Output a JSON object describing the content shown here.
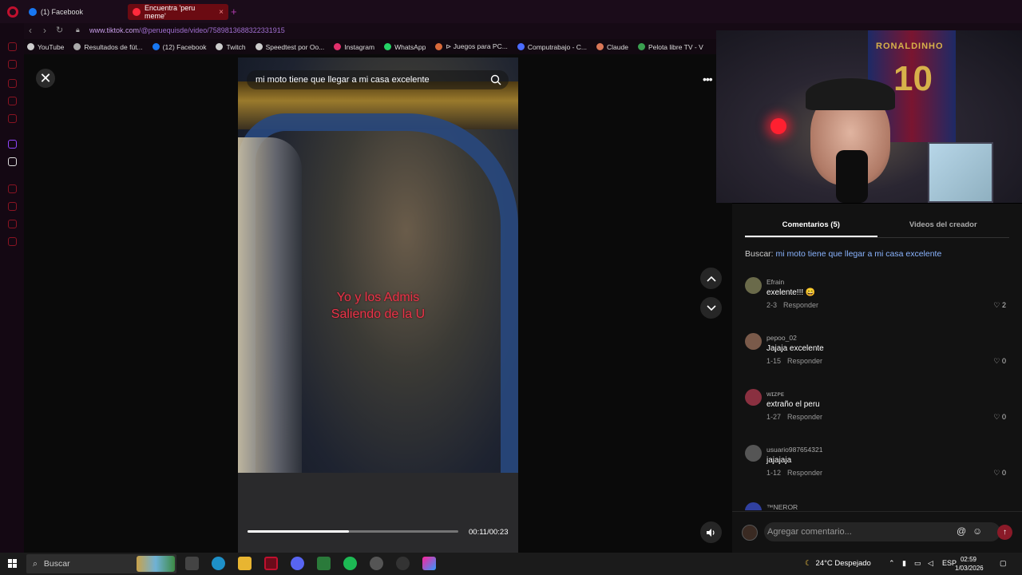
{
  "browser": {
    "tabs": [
      {
        "label": "(1) Facebook",
        "color": "#1877f2"
      },
      {
        "label": "Encuentra 'peru meme'",
        "color": "#ff2a3c",
        "active": true
      }
    ],
    "url_host": "www.tiktok.com",
    "url_path": "/@peruequisde/video/7589813688322331915",
    "bookmarks": [
      {
        "label": "YouTube",
        "icon": "page-icon",
        "color": "#cccccc"
      },
      {
        "label": "Resultados de fút...",
        "icon": "gear-icon",
        "color": "#aaaaaa"
      },
      {
        "label": "(12) Facebook",
        "icon": "facebook-icon",
        "color": "#1877f2"
      },
      {
        "label": "Twitch",
        "icon": "page-icon",
        "color": "#cccccc"
      },
      {
        "label": "Speedtest por Oo...",
        "icon": "speedtest-icon",
        "color": "#cccccc"
      },
      {
        "label": "Instagram",
        "icon": "instagram-icon",
        "color": "#e1306c"
      },
      {
        "label": "WhatsApp",
        "icon": "whatsapp-icon",
        "color": "#25d366"
      },
      {
        "label": "⊳ Juegos para PC...",
        "icon": "game-icon",
        "color": "#d86a3a"
      },
      {
        "label": "Computrabajo - C...",
        "icon": "computrabajo-icon",
        "color": "#4a6cff"
      },
      {
        "label": "Claude",
        "icon": "claude-icon",
        "color": "#d97757"
      },
      {
        "label": "Pelota libre TV - V",
        "icon": "tv-icon",
        "color": "#3aa050"
      }
    ]
  },
  "video": {
    "search_query": "mi moto tiene que llegar a mi casa excelente",
    "caption_line1": "Yo y los Admis",
    "caption_line2": "Saliendo de la U",
    "time": "00:11/00:23",
    "progress": 0.48
  },
  "panel": {
    "tab_comments": "Comentarios (5)",
    "tab_creator": "Videos del creador",
    "buscar_label": "Buscar:",
    "buscar_query": "mi moto tiene que llegar a mi casa excelente",
    "comments": [
      {
        "user": "Efrain",
        "text": "exelente!!! 😄",
        "date": "2-3",
        "reply": "Responder",
        "likes": "2",
        "avatar_color": "#6a6a4a"
      },
      {
        "user": "pepoo_02",
        "text": "Jajaja excelente",
        "date": "1-15",
        "reply": "Responder",
        "likes": "0",
        "avatar_color": "#7a5a4a"
      },
      {
        "user": "wɪᴢᴘᴇ",
        "text": "extraño el peru",
        "date": "1-27",
        "reply": "Responder",
        "likes": "0",
        "avatar_color": "#8a3040"
      },
      {
        "user": "usuario987654321",
        "text": "jajajaja",
        "date": "1-12",
        "reply": "Responder",
        "likes": "0",
        "avatar_color": "#555555"
      }
    ],
    "partial_user": "™NEROR",
    "comment_placeholder": "Agregar comentario..."
  },
  "webcam": {
    "jersey_text": "RONALDINHO",
    "jersey_number": "10"
  },
  "taskbar": {
    "search_label": "Buscar",
    "weather": "24°C  Despejado",
    "language": "ESP",
    "time": "02:59",
    "date": "1/03/2026"
  }
}
